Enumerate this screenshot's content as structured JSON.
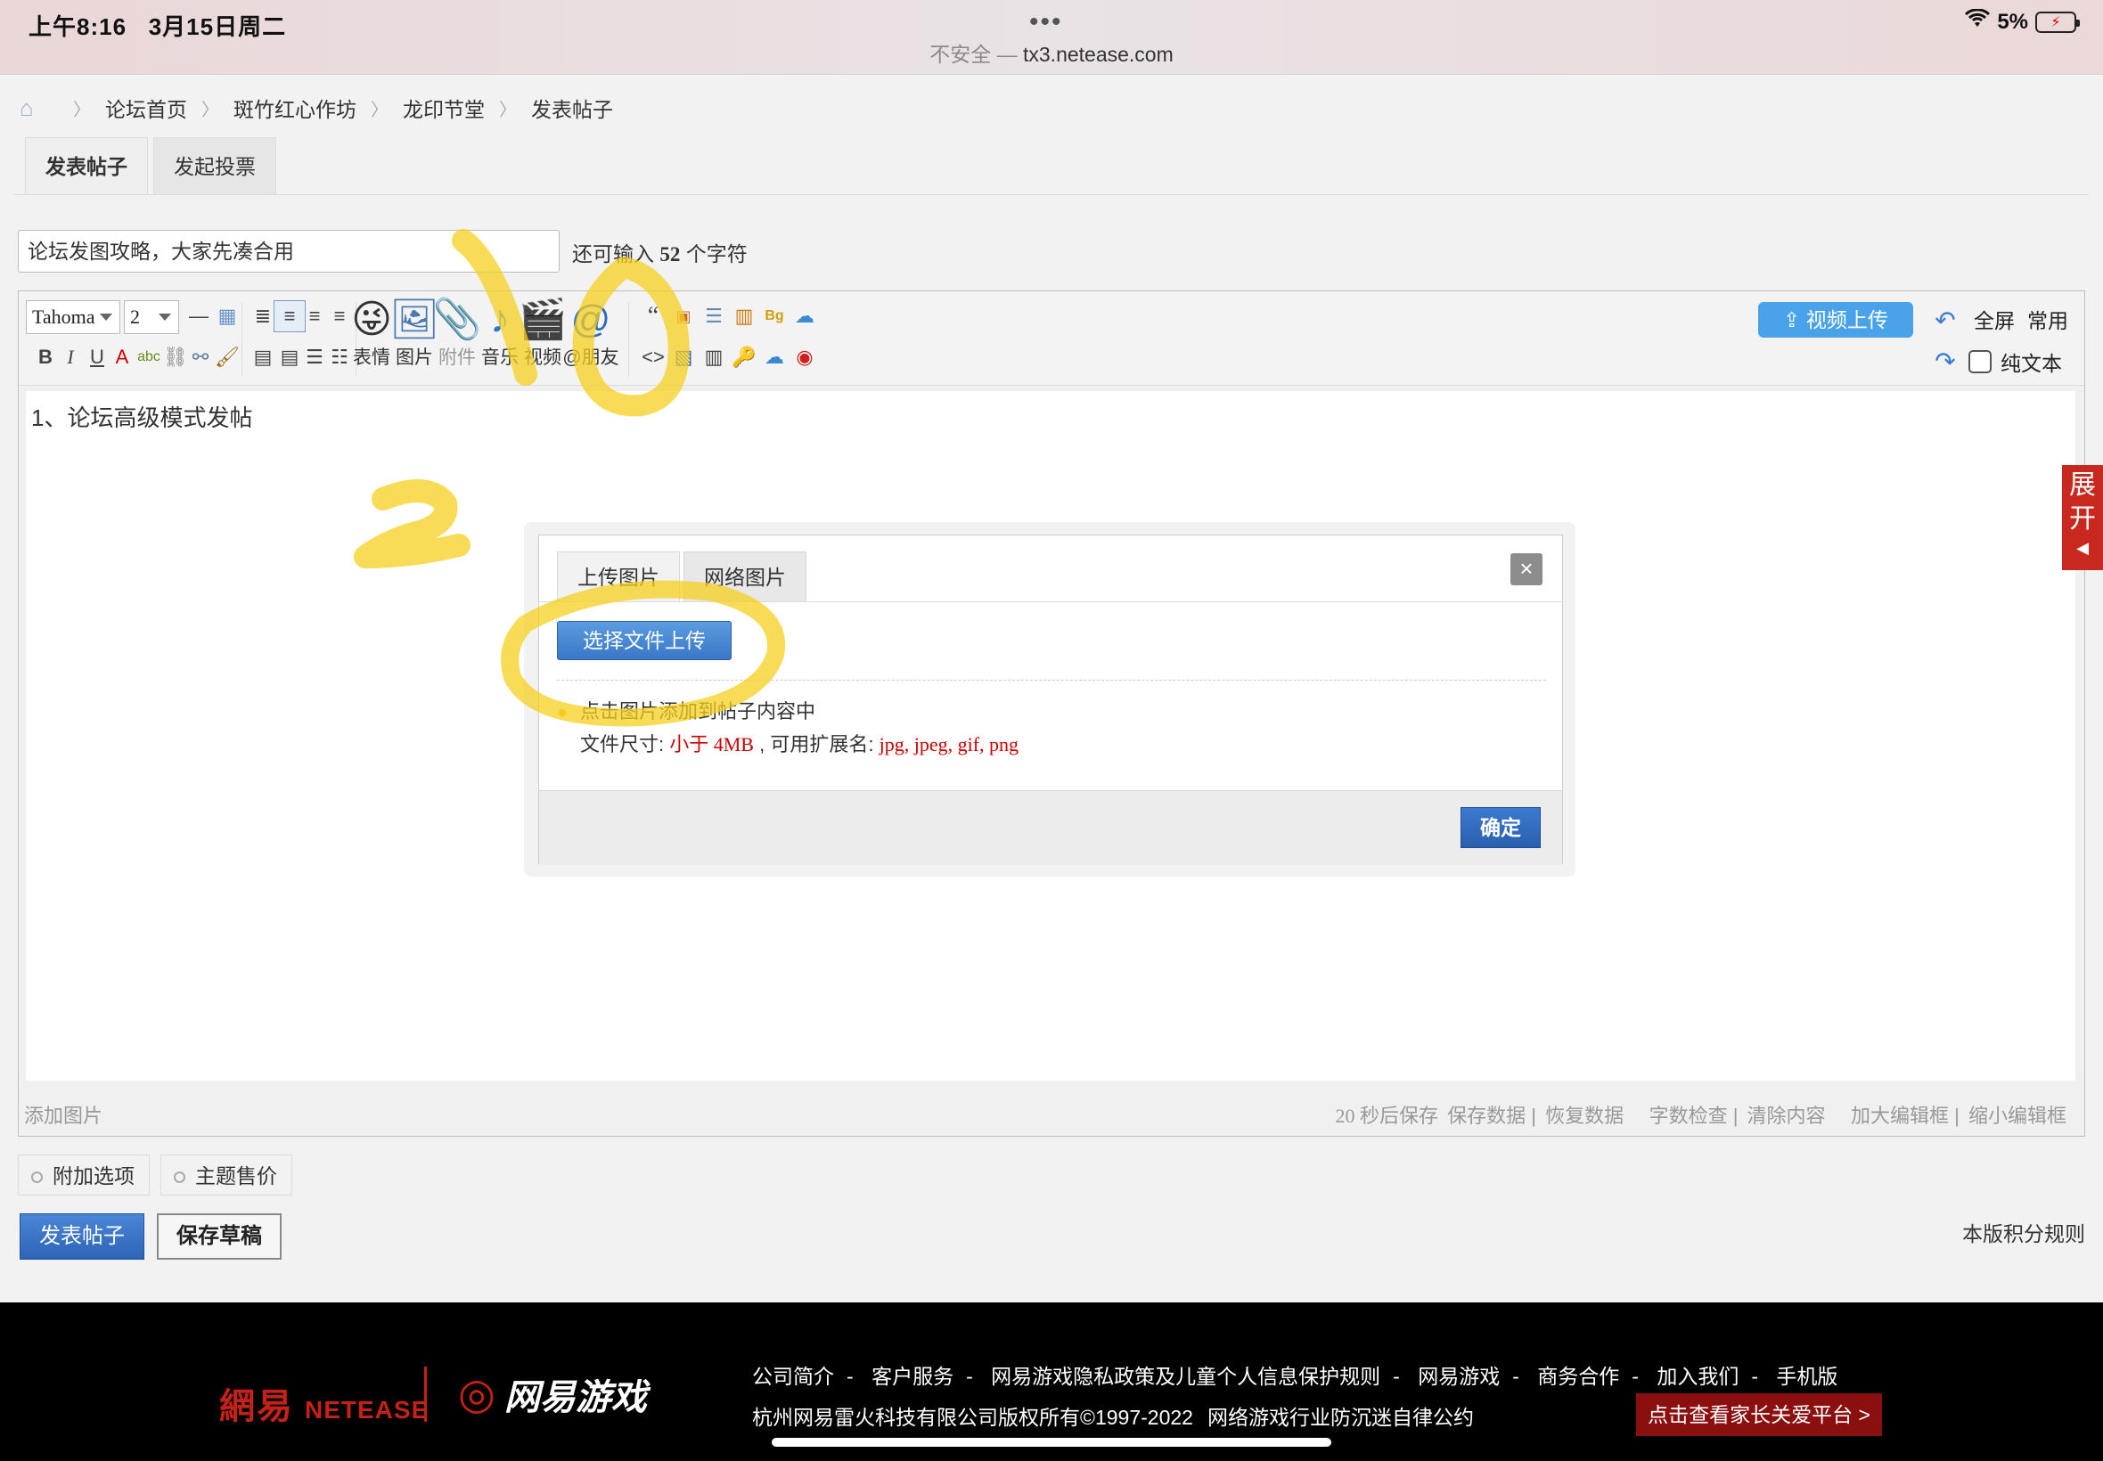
{
  "status_bar": {
    "time": "上午8:16",
    "date": "3月15日周二",
    "dots": "•••",
    "insecure": "不安全 —",
    "domain": "tx3.netease.com",
    "battery": "5%"
  },
  "breadcrumb": [
    "论坛首页",
    "斑竹红心作坊",
    "龙印节堂",
    "发表帖子"
  ],
  "tabs": [
    {
      "label": "发表帖子",
      "active": true
    },
    {
      "label": "发起投票",
      "active": false
    }
  ],
  "subject": {
    "value": "论坛发图攻略，大家先凑合用",
    "count_prefix": "还可输入",
    "count_number": "52",
    "count_suffix": "个字符"
  },
  "toolbar": {
    "font": "Tahoma",
    "size": "2",
    "big_buttons": [
      {
        "icon": "emoji-icon",
        "label": "表情"
      },
      {
        "icon": "image-icon",
        "label": "图片"
      },
      {
        "icon": "attachment-icon",
        "label": "附件"
      },
      {
        "icon": "music-icon",
        "label": "音乐"
      },
      {
        "icon": "video-icon",
        "label": "视频"
      },
      {
        "icon": "mention-icon",
        "label": "@朋友"
      }
    ],
    "video_upload": "视频上传",
    "fullscreen": "全屏",
    "common": "常用",
    "plain_text": "纯文本"
  },
  "editor": {
    "content": "1、论坛高级模式发帖",
    "add_image": "添加图片",
    "autosave": "20 秒后保存",
    "save_data": "保存数据",
    "restore_data": "恢复数据",
    "word_check": "字数检查",
    "clear_content": "清除内容",
    "enlarge": "加大编辑框",
    "shrink": "缩小编辑框"
  },
  "dialog": {
    "tab_upload": "上传图片",
    "tab_network": "网络图片",
    "close": "×",
    "choose_button": "选择文件上传",
    "tip_line1": "点击图片添加到帖子内容中",
    "size_label": "文件尺寸:",
    "size_value": "小于 4MB",
    "ext_label": ", 可用扩展名:",
    "ext_value": "jpg, jpeg, gif, png",
    "ok": "确定"
  },
  "side_expand": {
    "line1": "展",
    "line2": "开",
    "arrow": "◀"
  },
  "options": {
    "extra": "附加选项",
    "sell": "主题售价"
  },
  "actions": {
    "post": "发表帖子",
    "draft": "保存草稿",
    "rules": "本版积分规则"
  },
  "footer": {
    "logo_cn": "網易",
    "logo_en": "NETEASE",
    "games_logo": "网易游戏",
    "links": [
      "公司简介",
      "客户服务",
      "网易游戏隐私政策及儿童个人信息保护规则",
      "网易游戏",
      "商务合作",
      "加入我们",
      "手机版"
    ],
    "copyright": "杭州网易雷火科技有限公司版权所有©1997-2022",
    "addiction": "网络游戏行业防沉迷自律公约",
    "parent_btn": "点击查看家长关爱平台 >"
  },
  "colors": {
    "accent_blue": "#3a78c7",
    "brand_red": "#c6201b",
    "highlighter": "#f5d020"
  }
}
